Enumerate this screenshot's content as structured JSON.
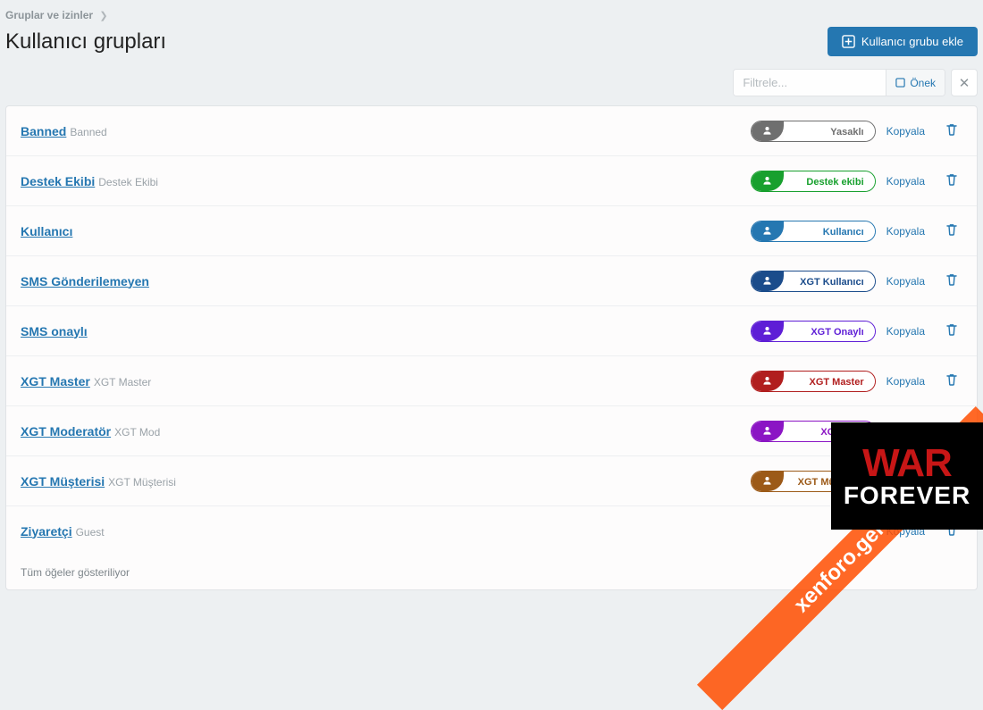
{
  "breadcrumb": {
    "root": "Gruplar ve izinler"
  },
  "page_title": "Kullanıcı grupları",
  "add_button": "Kullanıcı grubu ekle",
  "filter": {
    "placeholder": "Filtrele...",
    "prefix": "Önek"
  },
  "copy_label": "Kopyala",
  "footer": "Tüm öğeler gösteriliyor",
  "rows": [
    {
      "title": "Banned",
      "sub": "Banned",
      "badge": {
        "label": "Yasaklı",
        "color": "gray"
      }
    },
    {
      "title": "Destek Ekibi",
      "sub": "Destek Ekibi",
      "badge": {
        "label": "Destek ekibi",
        "color": "green"
      }
    },
    {
      "title": "Kullanıcı",
      "sub": "",
      "badge": {
        "label": "Kullanıcı",
        "color": "blue"
      }
    },
    {
      "title": "SMS Gönderilemeyen",
      "sub": "",
      "badge": {
        "label": "XGT Kullanıcı",
        "color": "navy"
      }
    },
    {
      "title": "SMS onaylı",
      "sub": "",
      "badge": {
        "label": "XGT Onaylı",
        "color": "violet"
      }
    },
    {
      "title": "XGT Master",
      "sub": "XGT Master",
      "badge": {
        "label": "XGT Master",
        "color": "red"
      }
    },
    {
      "title": "XGT Moderatör",
      "sub": "XGT Mod",
      "badge": {
        "label": "XGT Mod",
        "color": "purple"
      }
    },
    {
      "title": "XGT Müşterisi",
      "sub": "XGT Müşterisi",
      "badge": {
        "label": "XGT Müşterisi",
        "color": "brown"
      }
    },
    {
      "title": "Ziyaretçi",
      "sub": "Guest",
      "badge": null
    }
  ],
  "watermark": {
    "diag": "xenforo.gen.tr",
    "line1": "WAR",
    "line2": "FOREVER"
  }
}
